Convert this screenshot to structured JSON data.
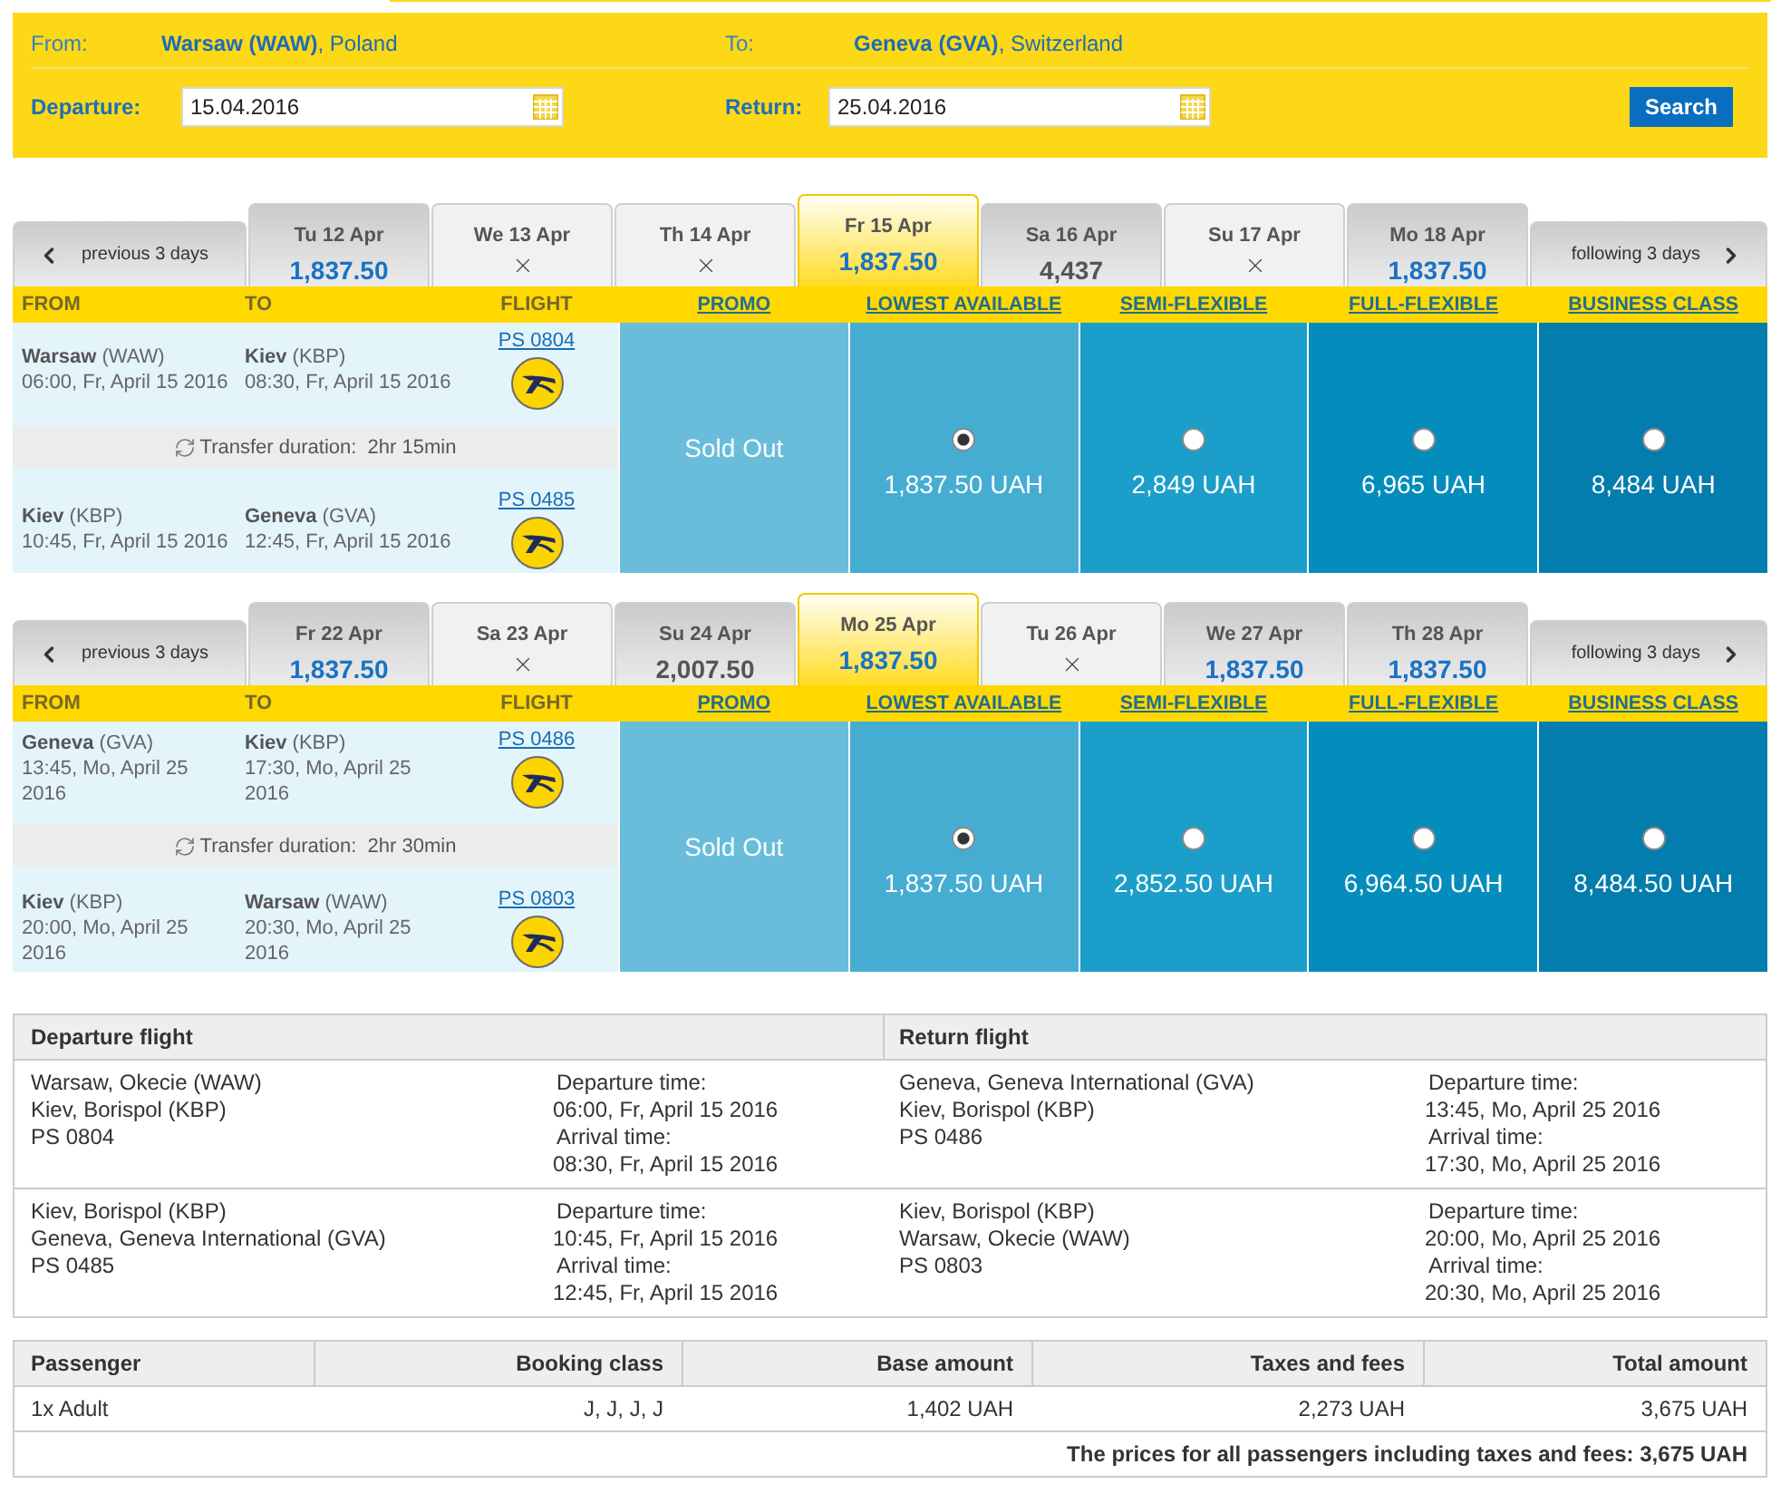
{
  "search_form": {
    "from_label": "From:",
    "from_value": "**Warsaw (WAW)**, Poland",
    "to_label": "To:",
    "to_value": "**Geneva (GVA)**, Switzerland",
    "departure_label": "Departure:",
    "departure_value": "15.04.2016",
    "return_label": "Return:",
    "return_value": "25.04.2016",
    "search_button": "Search"
  },
  "itineraries": [
    {
      "prev_days": "previous 3 days",
      "next_days": "following 3 days",
      "dates": [
        {
          "day": "Tu 12 Apr",
          "kind": "price",
          "price": "1,837.50",
          "lowest": true,
          "selected": false
        },
        {
          "day": "We 13 Apr",
          "kind": "none",
          "selected": false
        },
        {
          "day": "Th 14 Apr",
          "kind": "none",
          "selected": false
        },
        {
          "day": "Fr 15 Apr",
          "kind": "price",
          "price": "1,837.50",
          "lowest": true,
          "selected": true
        },
        {
          "day": "Sa 16 Apr",
          "kind": "price",
          "price": "4,437",
          "lowest": false,
          "selected": false
        },
        {
          "day": "Su 17 Apr",
          "kind": "none",
          "selected": false
        },
        {
          "day": "Mo 18 Apr",
          "kind": "price",
          "price": "1,837.50",
          "lowest": true,
          "selected": false
        }
      ],
      "columns": [
        "FROM",
        "TO",
        "FLIGHT"
      ],
      "fares": [
        {
          "label": "PROMO",
          "kind": "sold_out",
          "text": "Sold Out",
          "color": "#69bddb"
        },
        {
          "label": "LOWEST AVAILABLE",
          "kind": "price",
          "price": "1,837.50 UAH",
          "selected": true,
          "color": "#45add2"
        },
        {
          "label": "SEMI-FLEXIBLE",
          "kind": "price",
          "price": "2,849 UAH",
          "selected": false,
          "color": "#1b9fca"
        },
        {
          "label": "FULL-FLEXIBLE",
          "kind": "price",
          "price": "6,965 UAH",
          "selected": false,
          "color": "#048dbc"
        },
        {
          "label": "BUSINESS CLASS",
          "kind": "price",
          "price": "8,484 UAH",
          "selected": false,
          "color": "#037dad"
        }
      ],
      "segments": [
        {
          "from": "**Warsaw** (WAW)",
          "from_time": "06:00, Fr, April 15 2016",
          "to": "**Kiev** (KBP)",
          "to_time": "08:30, Fr, April 15 2016",
          "flight": "PS 0804"
        },
        {
          "from": "**Kiev** (KBP)",
          "from_time": "10:45, Fr, April 15 2016",
          "to": "**Geneva** (GVA)",
          "to_time": "12:45, Fr, April 15 2016",
          "flight": "PS 0485"
        }
      ],
      "transfer": "Transfer duration:  2hr 15min"
    },
    {
      "prev_days": "previous 3 days",
      "next_days": "following 3 days",
      "dates": [
        {
          "day": "Fr 22 Apr",
          "kind": "price",
          "price": "1,837.50",
          "lowest": true,
          "selected": false
        },
        {
          "day": "Sa 23 Apr",
          "kind": "none",
          "selected": false
        },
        {
          "day": "Su 24 Apr",
          "kind": "price",
          "price": "2,007.50",
          "lowest": false,
          "selected": false
        },
        {
          "day": "Mo 25 Apr",
          "kind": "price",
          "price": "1,837.50",
          "lowest": true,
          "selected": true
        },
        {
          "day": "Tu 26 Apr",
          "kind": "none",
          "selected": false
        },
        {
          "day": "We 27 Apr",
          "kind": "price",
          "price": "1,837.50",
          "lowest": true,
          "selected": false
        },
        {
          "day": "Th 28 Apr",
          "kind": "price",
          "price": "1,837.50",
          "lowest": true,
          "selected": false
        }
      ],
      "columns": [
        "FROM",
        "TO",
        "FLIGHT"
      ],
      "fares": [
        {
          "label": "PROMO",
          "kind": "sold_out",
          "text": "Sold Out",
          "color": "#69bddb"
        },
        {
          "label": "LOWEST AVAILABLE",
          "kind": "price",
          "price": "1,837.50 UAH",
          "selected": true,
          "color": "#45add2"
        },
        {
          "label": "SEMI-FLEXIBLE",
          "kind": "price",
          "price": "2,852.50 UAH",
          "selected": false,
          "color": "#1b9fca"
        },
        {
          "label": "FULL-FLEXIBLE",
          "kind": "price",
          "price": "6,964.50 UAH",
          "selected": false,
          "color": "#048dbc"
        },
        {
          "label": "BUSINESS CLASS",
          "kind": "price",
          "price": "8,484.50 UAH",
          "selected": false,
          "color": "#037dad"
        }
      ],
      "segments": [
        {
          "from": "**Geneva** (GVA)",
          "from_time": "13:45, Mo, April 25 2016",
          "to": "**Kiev** (KBP)",
          "to_time": "17:30, Mo, April 25 2016",
          "flight": "PS 0486"
        },
        {
          "from": "**Kiev** (KBP)",
          "from_time": "20:00, Mo, April 25 2016",
          "to": "**Warsaw** (WAW)",
          "to_time": "20:30, Mo, April 25 2016",
          "flight": "PS 0803"
        }
      ],
      "transfer": "Transfer duration:  2hr 30min"
    }
  ],
  "flight_summary": {
    "headers": [
      "Departure flight",
      "Return flight"
    ],
    "rows": [
      [
        {
          "from": "Warsaw, Okecie (WAW)",
          "to": "Kiev, Borispol (KBP)",
          "flight": "PS 0804",
          "departure_label": "Departure time:",
          "departure_time": "06:00, Fr, April 15 2016",
          "arrival_label": "Arrival time:",
          "arrival_time": "08:30, Fr, April 15 2016"
        },
        {
          "from": "Geneva, Geneva International (GVA)",
          "to": "Kiev, Borispol (KBP)",
          "flight": "PS 0486",
          "departure_label": "Departure time:",
          "departure_time": "13:45, Mo, April 25 2016",
          "arrival_label": "Arrival time:",
          "arrival_time": "17:30, Mo, April 25 2016"
        }
      ],
      [
        {
          "from": "Kiev, Borispol (KBP)",
          "to": "Geneva, Geneva International (GVA)",
          "flight": "PS 0485",
          "departure_label": "Departure time:",
          "departure_time": "10:45, Fr, April 15 2016",
          "arrival_label": "Arrival time:",
          "arrival_time": "12:45, Fr, April 15 2016"
        },
        {
          "from": "Kiev, Borispol (KBP)",
          "to": "Warsaw, Okecie (WAW)",
          "flight": "PS 0803",
          "departure_label": "Departure time:",
          "departure_time": "20:00, Mo, April 25 2016",
          "arrival_label": "Arrival time:",
          "arrival_time": "20:30, Mo, April 25 2016"
        }
      ]
    ]
  },
  "price_summary": {
    "columns": [
      "Passenger",
      "Booking class",
      "Base amount",
      "Taxes and fees",
      "Total amount"
    ],
    "rows": [
      [
        "1x Adult",
        "J, J, J, J",
        "1,402 UAH",
        "2,273 UAH",
        "3,675 UAH"
      ]
    ],
    "total": "The prices for all passengers including taxes and fees: 3,675 UAH"
  }
}
